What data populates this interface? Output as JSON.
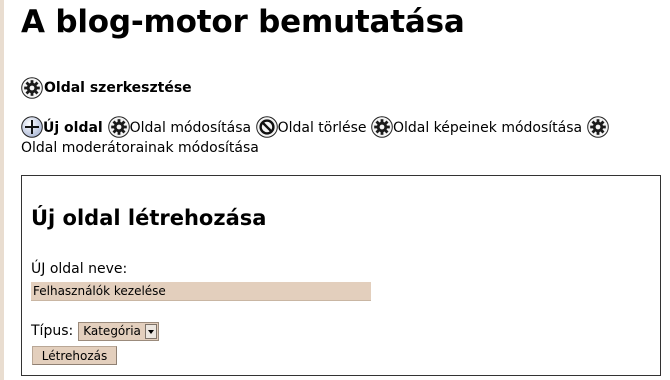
{
  "page": {
    "title": "A blog-motor bemutatása"
  },
  "section": {
    "icon": "gear-icon",
    "label": "Oldal szerkesztése"
  },
  "actions": [
    {
      "icon": "plus-circle-icon",
      "label": "Új oldal",
      "active": true
    },
    {
      "icon": "gear-icon",
      "label": "Oldal módosítása",
      "active": false
    },
    {
      "icon": "no-entry-icon",
      "label": "Oldal törlése",
      "active": false
    },
    {
      "icon": "gear-icon",
      "label": "Oldal képeinek módosítása",
      "active": false
    },
    {
      "icon": "gear-icon",
      "label": "Oldal moderátorainak módosítása",
      "active": false
    }
  ],
  "form": {
    "title": "Új oldal létrehozása",
    "name_label": "ÚJ oldal neve:",
    "name_value": "Felhasználók kezelése",
    "type_label": "Típus:",
    "type_selected": "Kategória",
    "submit_label": "Létrehozás"
  },
  "colors": {
    "field_background": "#e3cfbd",
    "left_rule": "#e9ddd0"
  }
}
